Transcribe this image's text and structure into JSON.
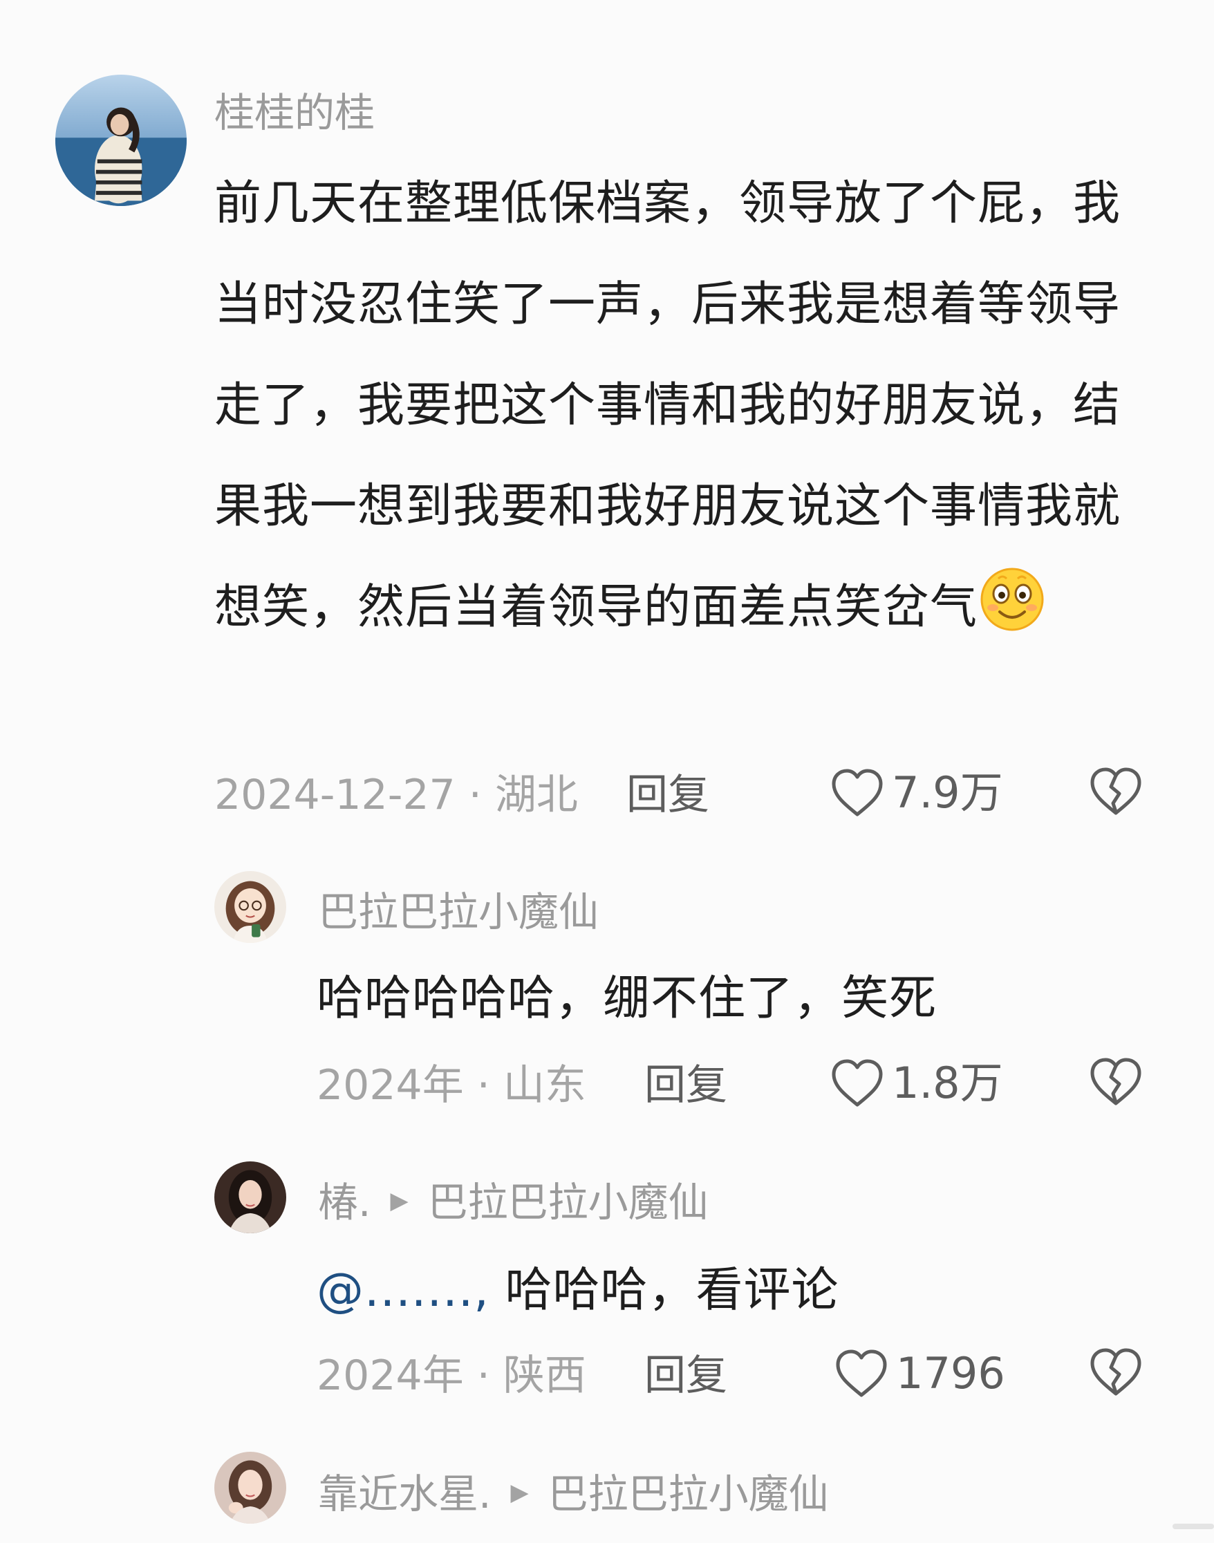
{
  "comments": [
    {
      "username": "桂桂的桂",
      "text": "前几天在整理低保档案，领导放了个屁，我当时没忍住笑了一声，后来我是想着等领导走了，我要把这个事情和我的好朋友说，结果我一想到我要和我好朋友说这个事情我就想笑，然后当着领导的面差点笑岔气",
      "emoji": "grinning-face-emoji",
      "date_location": "2024-12-27 · 湖北",
      "reply_label": "回复",
      "likes": "7.9万"
    },
    {
      "username": "巴拉巴拉小魔仙",
      "text": "哈哈哈哈哈，绷不住了，笑死",
      "date_location": "2024年 · 山东",
      "reply_label": "回复",
      "likes": "1.8万"
    },
    {
      "username": "椿.",
      "reply_to": "巴拉巴拉小魔仙",
      "mention": "@.......,",
      "text": " 哈哈哈，看评论",
      "date_location": "2024年 · 陕西",
      "reply_label": "回复",
      "likes": "1796"
    },
    {
      "username": "靠近水星.",
      "reply_to": "巴拉巴拉小魔仙"
    }
  ],
  "colors": {
    "background": "#fbfbfb",
    "text": "#1e1e1e",
    "muted": "#a4a4a4",
    "mention": "#1f4f82"
  },
  "icons": {
    "like": "heart-outline-icon",
    "dislike": "broken-heart-icon",
    "reply_arrow": "triangle-right-icon"
  }
}
